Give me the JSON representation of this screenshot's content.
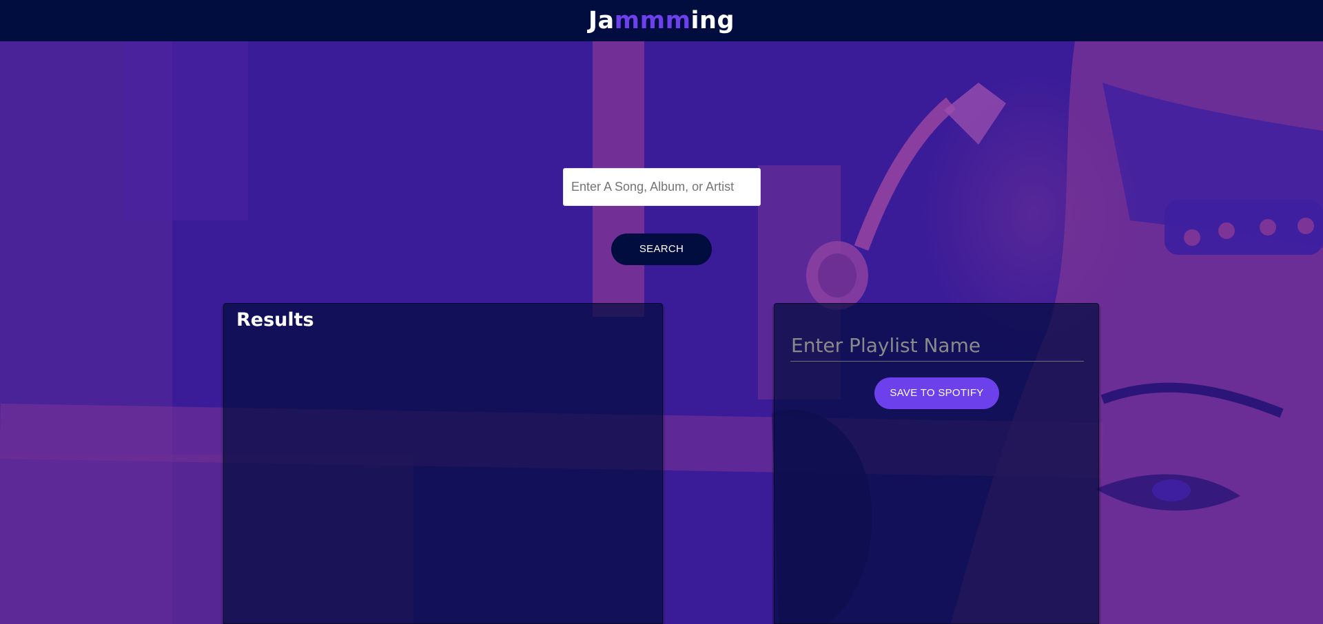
{
  "header": {
    "brand_prefix": "Ja",
    "brand_highlight": "mmm",
    "brand_suffix": "ing"
  },
  "search": {
    "placeholder": "Enter A Song, Album, or Artist",
    "value": "",
    "button_label": "SEARCH"
  },
  "results": {
    "title": "Results",
    "tracks": []
  },
  "playlist": {
    "name_placeholder": "Enter Playlist Name",
    "name_value": "",
    "save_label": "SAVE TO SPOTIFY",
    "tracks": []
  },
  "colors": {
    "navy": "#010c3f",
    "accent": "#6c41ec",
    "background_purple": "#3e1f9c",
    "background_magenta": "#6b2a8c"
  }
}
